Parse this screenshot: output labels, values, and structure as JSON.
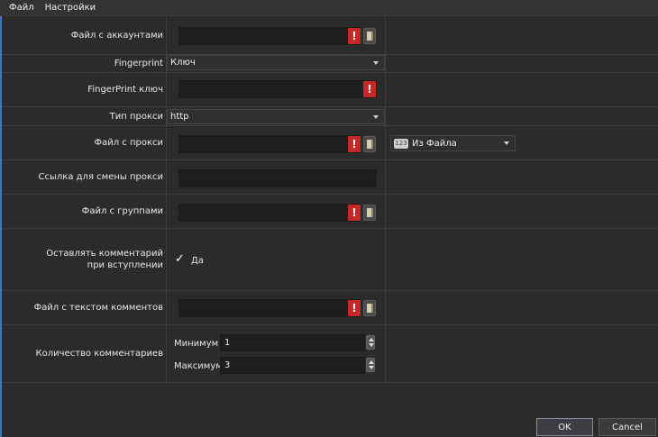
{
  "menu": {
    "file": "Файл",
    "settings": "Настройки"
  },
  "form": {
    "accounts_file_label": "Файл с аккаунтами",
    "fingerprint_label": "Fingerprint",
    "fingerprint_value": "Ключ",
    "fingerprint_key_label": "FingerPrint ключ",
    "proxy_type_label": "Тип прокси",
    "proxy_type_value": "http",
    "proxy_file_label": "Файл с прокси",
    "proxy_source_value": "Из Файла",
    "proxy_source_icon": "123",
    "proxy_change_link_label": "Ссылка для смены прокси",
    "groups_file_label": "Файл с группами",
    "leave_comment_label": "Оставлять комментарий при вступлении",
    "leave_comment_check_label": "Да",
    "comments_text_file_label": "Файл с текстом комментов",
    "comments_count_label": "Количество комментариев",
    "min_label": "Минимум",
    "min_value": "1",
    "max_label": "Максимум",
    "max_value": "3"
  },
  "buttons": {
    "ok": "OK",
    "cancel": "Cancel"
  },
  "colors": {
    "accent": "#3a78c9",
    "error": "#c62828",
    "background": "#2b2b2b"
  }
}
